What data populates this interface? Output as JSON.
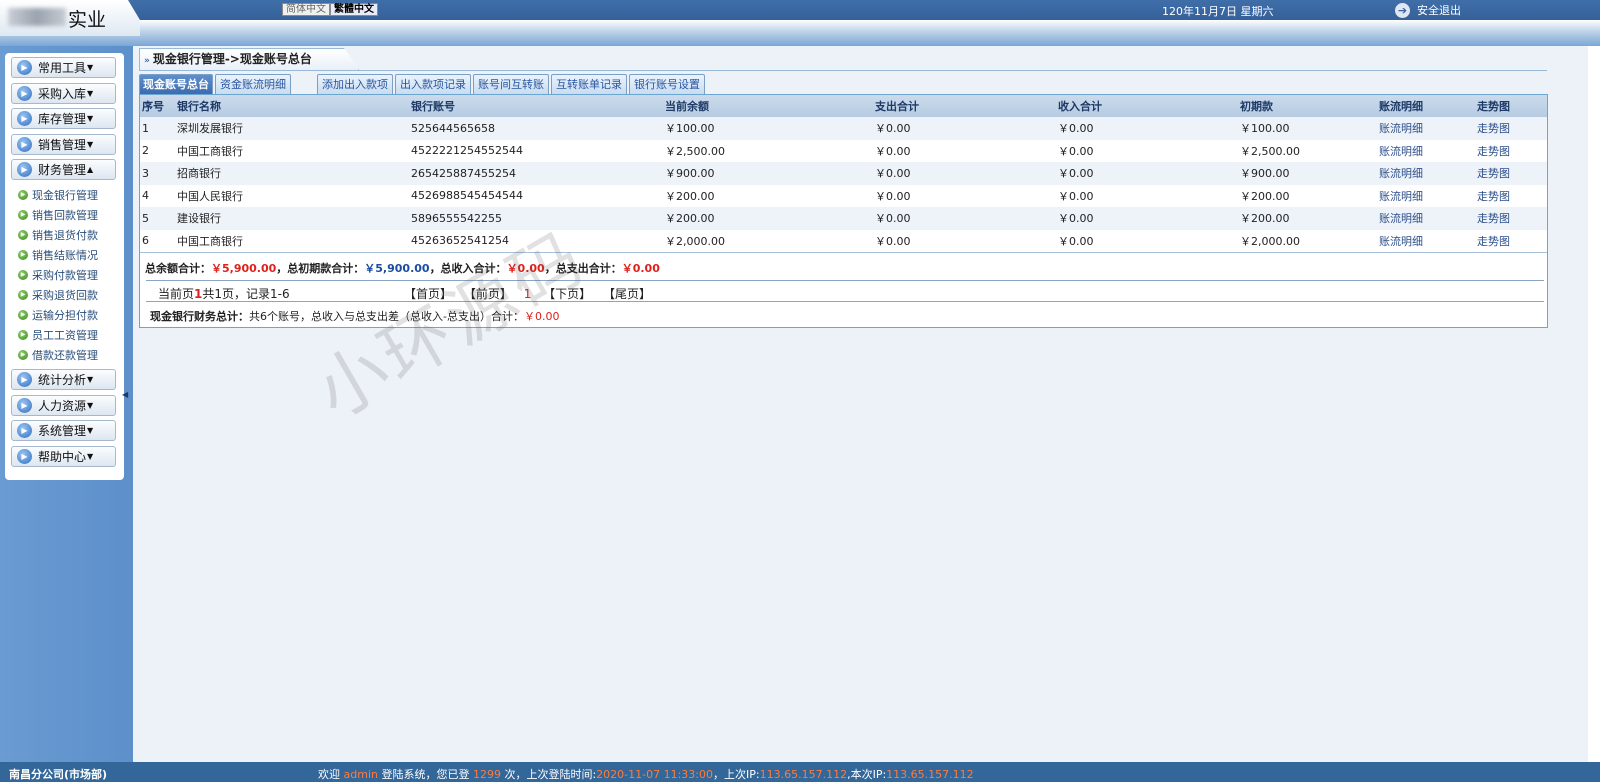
{
  "header": {
    "logo_text": "实业",
    "lang_simplified": "简体中文",
    "lang_traditional": "繁體中文",
    "date": "120年11月7日 星期六",
    "logout_label": "安全退出"
  },
  "sidebar": {
    "menus_top": [
      {
        "label": "常用工具"
      },
      {
        "label": "采购入库"
      },
      {
        "label": "库存管理"
      },
      {
        "label": "销售管理"
      },
      {
        "label": "财务管理"
      }
    ],
    "finance_submenu": [
      "现金银行管理",
      "销售回款管理",
      "销售退货付款",
      "销售结账情况",
      "采购付款管理",
      "采购退货回款",
      "运输分担付款",
      "员工工资管理",
      "借款还款管理"
    ],
    "menus_bottom": [
      {
        "label": "统计分析"
      },
      {
        "label": "人力资源"
      },
      {
        "label": "系统管理"
      },
      {
        "label": "帮助中心"
      }
    ]
  },
  "breadcrumb": "现金银行管理->现金账号总台",
  "tabs": [
    {
      "label": "现金账号总台",
      "active": true
    },
    {
      "label": "资金账流明细",
      "active": false
    },
    {
      "label": "添加出入款项",
      "active": false
    },
    {
      "label": "出入款项记录",
      "active": false
    },
    {
      "label": "账号间互转账",
      "active": false
    },
    {
      "label": "互转账单记录",
      "active": false
    },
    {
      "label": "银行账号设置",
      "active": false
    }
  ],
  "table": {
    "headers": [
      "序号",
      "银行名称",
      "银行账号",
      "当前余额",
      "支出合计",
      "收入合计",
      "初期款",
      "账流明细",
      "走势图"
    ],
    "rows": [
      [
        "1",
        "深圳发展银行",
        "525644565658",
        "￥100.00",
        "￥0.00",
        "￥0.00",
        "￥100.00",
        "账流明细",
        "走势图"
      ],
      [
        "2",
        "中国工商银行",
        "4522221254552544",
        "￥2,500.00",
        "￥0.00",
        "￥0.00",
        "￥2,500.00",
        "账流明细",
        "走势图"
      ],
      [
        "3",
        "招商银行",
        "265425887455254",
        "￥900.00",
        "￥0.00",
        "￥0.00",
        "￥900.00",
        "账流明细",
        "走势图"
      ],
      [
        "4",
        "中国人民银行",
        "4526988545454544",
        "￥200.00",
        "￥0.00",
        "￥0.00",
        "￥200.00",
        "账流明细",
        "走势图"
      ],
      [
        "5",
        "建设银行",
        "5896555542255",
        "￥200.00",
        "￥0.00",
        "￥0.00",
        "￥200.00",
        "账流明细",
        "走势图"
      ],
      [
        "6",
        "中国工商银行",
        "45263652541254",
        "￥2,000.00",
        "￥0.00",
        "￥0.00",
        "￥2,000.00",
        "账流明细",
        "走势图"
      ]
    ]
  },
  "totals": {
    "balance_label": "总余额合计：",
    "balance_value": "￥5,900.00",
    "initial_label": "，总初期款合计：",
    "initial_value": "￥5,900.00",
    "income_label": "，总收入合计：",
    "income_value": "￥0.00",
    "expense_label": "，总支出合计：",
    "expense_value": "￥0.00"
  },
  "pager": {
    "prefix": "当前页",
    "current": "1",
    "suffix": "共1页，记录1-6",
    "first": "【首页】",
    "prev": "【前页】",
    "page_num": "1",
    "next": "【下页】",
    "last": "【尾页】"
  },
  "summary": {
    "label": "现金银行财务总计：",
    "text": "共6个账号，总收入与总支出差（总收入-总支出）合计：",
    "value": "￥0.00"
  },
  "watermark": "小环源码",
  "footer": {
    "company": "南昌分公司(市场部)",
    "welcome_prefix": "欢迎 ",
    "user": "admin",
    "login_text": " 登陆系统，您已登 ",
    "login_count": "1299",
    "times_text": " 次，上次登陆时间:",
    "last_login_time": "2020-11-07 11:33:00",
    "last_ip_label": "，上次IP:",
    "last_ip": "113.65.157.112",
    "current_ip_label": ",本次IP:",
    "current_ip": "113.65.157.112"
  },
  "colors": {
    "header_blue": "#3f6ea8",
    "active_tab": "#3c6cb0",
    "total_red": "#e0201a",
    "footer_bg": "#336699",
    "footer_highlight": "#ff7b3a"
  }
}
